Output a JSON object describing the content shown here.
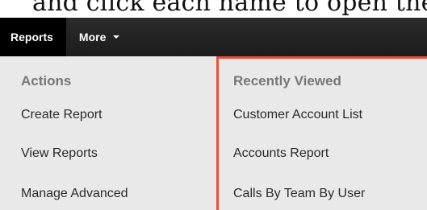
{
  "caption": "and click each name to open the",
  "navbar": {
    "tabs": [
      {
        "label": "Reports"
      },
      {
        "label": "More"
      }
    ]
  },
  "dropdown": {
    "actions": {
      "title": "Actions",
      "items": [
        "Create Report",
        "View Reports",
        "Manage Advanced"
      ]
    },
    "recent": {
      "title": "Recently Viewed",
      "items": [
        "Customer Account List",
        "Accounts Report",
        "Calls By Team By User"
      ]
    }
  },
  "colors": {
    "navbar_bg": "#1c1c1c",
    "active_tab_bg": "#000000",
    "dropdown_bg": "#e9e9e9",
    "highlight_border": "#e8503a"
  },
  "icons": {
    "more_caret": "chevron-down-icon"
  }
}
